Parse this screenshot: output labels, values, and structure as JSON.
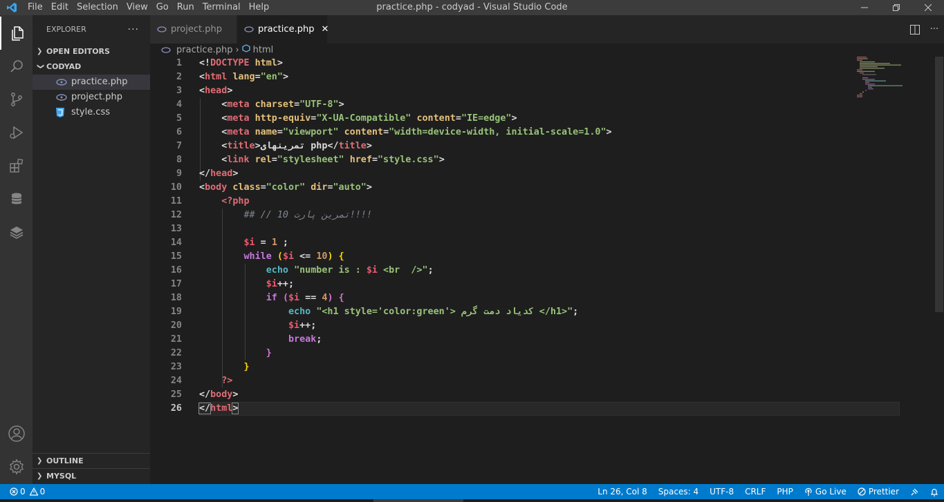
{
  "window": {
    "title": "practice.php - codyad - Visual Studio Code",
    "menu": [
      "File",
      "Edit",
      "Selection",
      "View",
      "Go",
      "Run",
      "Terminal",
      "Help"
    ]
  },
  "activity_bar": [
    "explorer-icon",
    "search-icon",
    "source-control-icon",
    "run-debug-icon",
    "extensions-icon",
    "database-icon",
    "layers-icon",
    "account-icon",
    "settings-gear-icon"
  ],
  "sidebar": {
    "title": "EXPLORER",
    "more": "···",
    "open_editors": "OPEN EDITORS",
    "folder": "CODYAD",
    "files": [
      {
        "name": "practice.php",
        "icon": "php-icon",
        "selected": true
      },
      {
        "name": "project.php",
        "icon": "php-icon",
        "selected": false
      },
      {
        "name": "style.css",
        "icon": "css-icon",
        "selected": false
      }
    ],
    "outline": "OUTLINE",
    "mysql": "MYSQL"
  },
  "tabs": [
    {
      "label": "project.php",
      "active": false
    },
    {
      "label": "practice.php",
      "active": true
    }
  ],
  "breadcrumb": {
    "file": "practice.php",
    "symbol": "html"
  },
  "editor": {
    "line_numbers": [
      "1",
      "2",
      "3",
      "4",
      "5",
      "6",
      "7",
      "8",
      "9",
      "10",
      "11",
      "12",
      "13",
      "14",
      "15",
      "16",
      "17",
      "18",
      "19",
      "20",
      "21",
      "22",
      "23",
      "24",
      "25",
      "26"
    ],
    "current_line": "26",
    "lines": {
      "l1": [
        "<!",
        "DOCTYPE",
        " ",
        "html",
        ">"
      ],
      "l2": [
        "<",
        "html",
        " ",
        "lang",
        "=",
        "\"en\"",
        ">"
      ],
      "l3": [
        "<",
        "head",
        ">"
      ],
      "l4": [
        "    ",
        "<",
        "meta",
        " ",
        "charset",
        "=",
        "\"UTF-8\"",
        ">"
      ],
      "l5": [
        "    ",
        "<",
        "meta",
        " ",
        "http-equiv",
        "=",
        "\"X-UA-Compatible\"",
        " ",
        "content",
        "=",
        "\"IE=edge\"",
        ">"
      ],
      "l6": [
        "    ",
        "<",
        "meta",
        " ",
        "name",
        "=",
        "\"viewport\"",
        " ",
        "content",
        "=",
        "\"width=device-width, initial-scale=1.0\"",
        ">"
      ],
      "l7": [
        "    ",
        "<",
        "title",
        ">",
        "تمرینهای php",
        "</",
        "title",
        ">"
      ],
      "l8": [
        "    ",
        "<",
        "link",
        " ",
        "rel",
        "=",
        "\"stylesheet\"",
        " ",
        "href",
        "=",
        "\"style.css\"",
        ">"
      ],
      "l9": [
        "</",
        "head",
        ">"
      ],
      "l10": [
        "<",
        "body",
        " ",
        "class",
        "=",
        "\"color\"",
        " ",
        "dir",
        "=",
        "\"auto\"",
        ">"
      ],
      "l11": [
        "    ",
        "<?php"
      ],
      "l12": [
        "        ",
        "## // تمرین پارت 10!!!!"
      ],
      "l13": [
        ""
      ],
      "l14": [
        "        ",
        "$i",
        " = ",
        "1",
        " ;"
      ],
      "l15": [
        "        ",
        "while",
        " ",
        "(",
        "$i",
        " <= ",
        "10",
        ")",
        " ",
        "{"
      ],
      "l16": [
        "            ",
        "echo",
        " ",
        "\"number is : ",
        "$i",
        " <br  />\"",
        ";"
      ],
      "l17": [
        "            ",
        "$i",
        "++;"
      ],
      "l18": [
        "            ",
        "if",
        " ",
        "(",
        "$i",
        " == ",
        "4",
        ")",
        " ",
        "{"
      ],
      "l19": [
        "                ",
        "echo",
        " ",
        "\"<h1 style='color:green'> کدیاد دمت گرم </h1>\"",
        ";"
      ],
      "l20": [
        "                ",
        "$i",
        "++;"
      ],
      "l21": [
        "                ",
        "break",
        ";"
      ],
      "l22": [
        "            ",
        "}"
      ],
      "l23": [
        "        ",
        "}"
      ],
      "l24": [
        "    ",
        "?>"
      ],
      "l25": [
        "</",
        "body",
        ">"
      ],
      "l26": [
        "</",
        "html",
        ">"
      ]
    }
  },
  "statusbar": {
    "errors": "0",
    "warnings": "0",
    "position": "Ln 26, Col 8",
    "spaces": "Spaces: 4",
    "encoding": "UTF-8",
    "eol": "CRLF",
    "language": "PHP",
    "go_live": "Go Live",
    "prettier": "Prettier"
  },
  "colors": {
    "accent": "#007acc",
    "tag": "#e06c75",
    "attribute": "#e5c07b",
    "string": "#98c379",
    "keyword": "#c678dd",
    "function": "#56b6c2",
    "number": "#d19a66"
  }
}
